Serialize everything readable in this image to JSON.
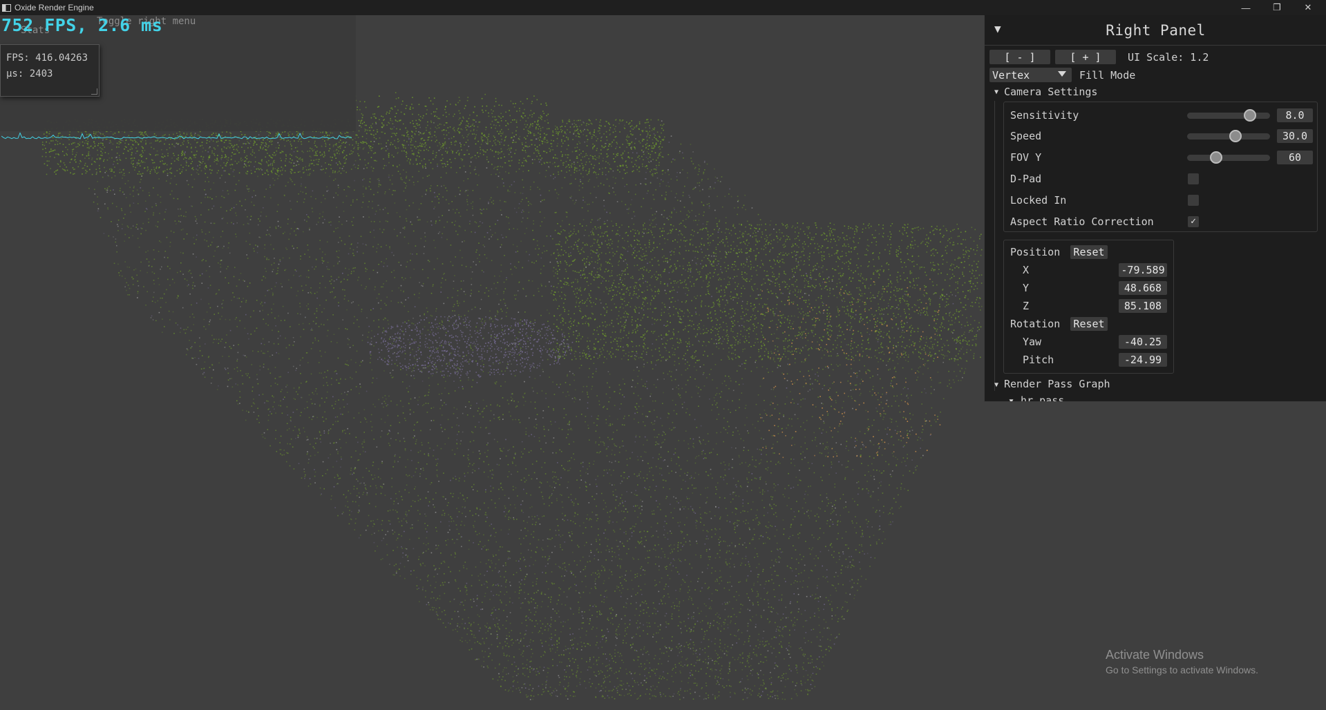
{
  "window": {
    "title": "Oxide Render Engine",
    "controls": {
      "minimize": "—",
      "maximize": "❐",
      "close": "✕"
    }
  },
  "stats": {
    "hint": "Toggle right menu",
    "title": "Stats",
    "fps_big": "752 FPS, 2.6 ms",
    "fps_line": "FPS: 416.04263",
    "us_line": "μs: 2403"
  },
  "right_panel": {
    "title": "Right Panel",
    "collapse_icon": "▼",
    "scale_minus": "[  -  ]",
    "scale_plus": "[  +  ]",
    "ui_scale": "UI Scale: 1.2",
    "fill_mode": {
      "selected": "Vertex",
      "label": "Fill Mode"
    },
    "camera_settings": {
      "header": "Camera Settings",
      "sensitivity": {
        "label": "Sensitivity",
        "value": "8.0",
        "fraction": 0.76
      },
      "speed": {
        "label": "Speed",
        "value": "30.0",
        "fraction": 0.58
      },
      "fov_y": {
        "label": "FOV Y",
        "value": "60",
        "fraction": 0.35
      },
      "dpad": {
        "label": "D-Pad",
        "checked": false
      },
      "locked_in": {
        "label": "Locked In",
        "checked": false
      },
      "aspect_ratio": {
        "label": "Aspect Ratio Correction",
        "checked": true,
        "mark": "✓"
      }
    },
    "transform": {
      "position_label": "Position",
      "reset": "Reset",
      "x": {
        "label": "X",
        "value": "-79.589"
      },
      "y": {
        "label": "Y",
        "value": "48.668"
      },
      "z": {
        "label": "Z",
        "value": "85.108"
      },
      "rotation_label": "Rotation",
      "yaw": {
        "label": "Yaw",
        "value": "-40.25"
      },
      "pitch": {
        "label": "Pitch",
        "value": "-24.99"
      }
    },
    "render_pass_graph": {
      "header": "Render Pass Graph",
      "partial_item": "▾ hr pass"
    }
  },
  "watermark": {
    "title": "Activate Windows",
    "subtitle": "Go to Settings to activate Windows."
  },
  "colors": {
    "accent_cyan": "#43d3e8",
    "point_green": "#6e9a2c",
    "point_orange": "#c08a4a",
    "point_purple": "#7a6f9a",
    "panel_bg": "#1d1d1d",
    "viewport_bg": "#3f3f3f"
  }
}
